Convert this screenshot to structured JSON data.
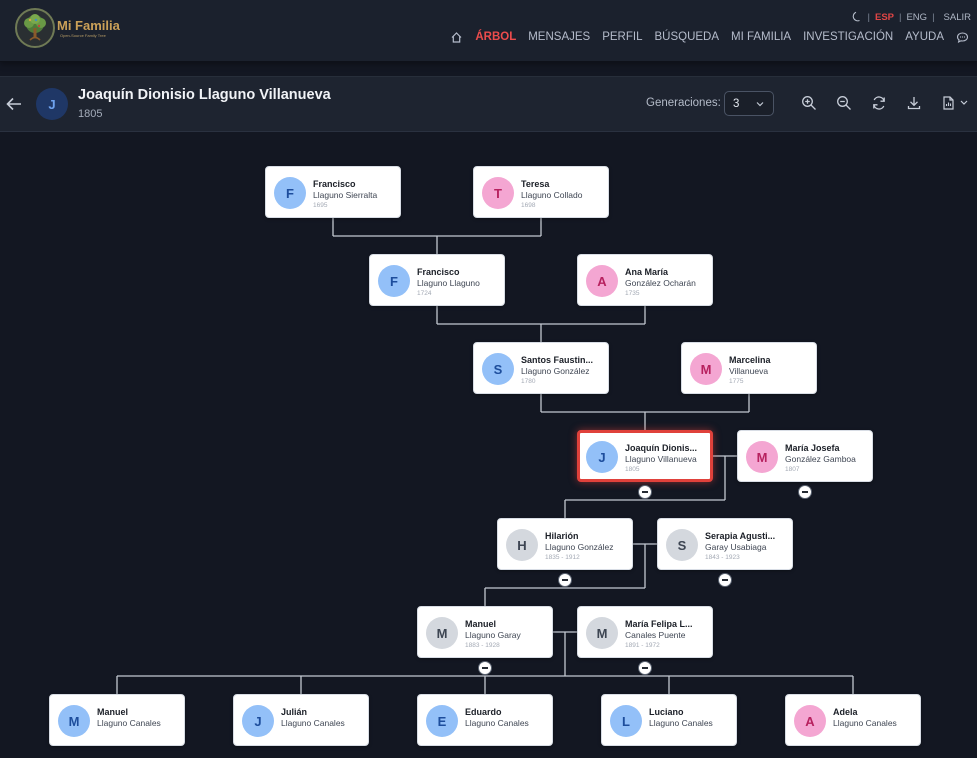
{
  "brand": {
    "title": "Mi Familia",
    "subtitle": "Open-Source Family Tree"
  },
  "languages": {
    "esp": "ESP",
    "eng": "ENG",
    "logout": "SALIR"
  },
  "nav": {
    "items": [
      "ÁRBOL",
      "MENSAJES",
      "PERFIL",
      "BÚSQUEDA",
      "MI FAMILIA",
      "INVESTIGACIÓN",
      "AYUDA"
    ],
    "active": "ÁRBOL"
  },
  "person": {
    "initial": "J",
    "name": "Joaquín Dionisio Llaguno Villanueva",
    "year": "1805"
  },
  "generations": {
    "label": "Generaciones:",
    "value": "3"
  },
  "toolbar_icons": [
    "zoom-in-icon",
    "zoom-out-icon",
    "refresh-icon",
    "download-icon",
    "export-icon"
  ],
  "colors": {
    "accent": "#e0413b",
    "background": "#131722",
    "male_avatar": "#93c0f8",
    "female_avatar": "#f4a6d2",
    "unknown_avatar": "#d4d8de"
  },
  "tree": {
    "cards": [
      {
        "id": "gg1",
        "initial": "F",
        "first": "Francisco",
        "last": "Llaguno Sierralta",
        "years": "1695",
        "gender": "male"
      },
      {
        "id": "gg2",
        "initial": "T",
        "first": "Teresa",
        "last": "Llaguno Collado",
        "years": "1698",
        "gender": "female"
      },
      {
        "id": "g1",
        "initial": "F",
        "first": "Francisco",
        "last": "Llaguno Llaguno",
        "years": "1724",
        "gender": "male"
      },
      {
        "id": "g2",
        "initial": "A",
        "first": "Ana María",
        "last": "González Ocharán",
        "years": "1735",
        "gender": "female"
      },
      {
        "id": "p1",
        "initial": "S",
        "first": "Santos Faustin...",
        "last": "Llaguno González",
        "years": "1780",
        "gender": "male"
      },
      {
        "id": "p2",
        "initial": "M",
        "first": "Marcelina",
        "last": "Villanueva",
        "years": "1775",
        "gender": "female"
      },
      {
        "id": "focus",
        "initial": "J",
        "first": "Joaquín Dionis...",
        "last": "Llaguno Villanueva",
        "years": "1805",
        "gender": "male",
        "selected": true
      },
      {
        "id": "spouse",
        "initial": "M",
        "first": "María Josefa",
        "last": "González Gamboa",
        "years": "1807",
        "gender": "female"
      },
      {
        "id": "c1",
        "initial": "H",
        "first": "Hilarión",
        "last": "Llaguno González",
        "years": "1835 - 1912",
        "gender": "unknown"
      },
      {
        "id": "c1s",
        "initial": "S",
        "first": "Serapia Agusti...",
        "last": "Garay Usabiaga",
        "years": "1843 - 1923",
        "gender": "unknown"
      },
      {
        "id": "gc1",
        "initial": "M",
        "first": "Manuel",
        "last": "Llaguno Garay",
        "years": "1883 - 1928",
        "gender": "unknown"
      },
      {
        "id": "gc1s",
        "initial": "M",
        "first": "María Felipa L...",
        "last": "Canales Puente",
        "years": "1891 - 1972",
        "gender": "unknown"
      },
      {
        "id": "ggc1",
        "initial": "M",
        "first": "Manuel",
        "last": "Llaguno Canales",
        "years": "",
        "gender": "male"
      },
      {
        "id": "ggc2",
        "initial": "J",
        "first": "Julián",
        "last": "Llaguno Canales",
        "years": "",
        "gender": "male"
      },
      {
        "id": "ggc3",
        "initial": "E",
        "first": "Eduardo",
        "last": "Llaguno Canales",
        "years": "",
        "gender": "male"
      },
      {
        "id": "ggc4",
        "initial": "L",
        "first": "Luciano",
        "last": "Llaguno Canales",
        "years": "",
        "gender": "male"
      },
      {
        "id": "ggc5",
        "initial": "A",
        "first": "Adela",
        "last": "Llaguno Canales",
        "years": "",
        "gender": "female"
      }
    ]
  }
}
